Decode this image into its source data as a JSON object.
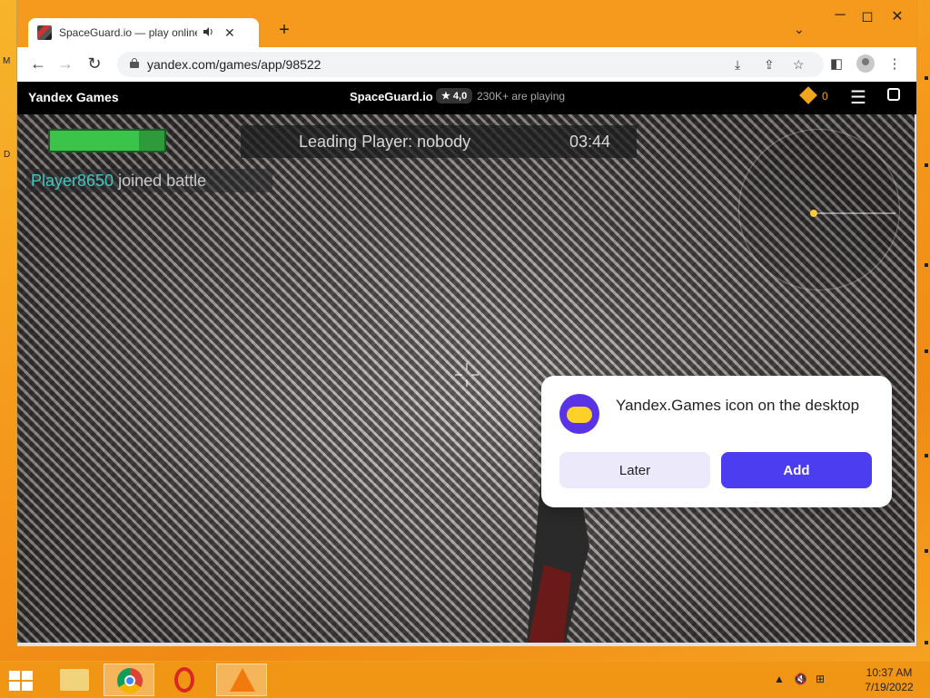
{
  "tab": {
    "title": "SpaceGuard.io — play online",
    "audio_icon": "speaker-icon",
    "close": "✕",
    "new_tab": "+"
  },
  "toolbar": {
    "back": "←",
    "forward": "→",
    "reload": "↻",
    "url": "yandex.com/games/app/98522"
  },
  "yandex_header": {
    "brand": "Yandex Games",
    "game_title": "SpaceGuard.io",
    "rating": "★ 4,0",
    "players": "230K+ are playing",
    "coins": "0"
  },
  "game": {
    "health_fraction": 0.78,
    "leading_player": "Leading Player: nobody",
    "timer": "03:44",
    "killfeed_player": "Player8650",
    "killfeed_action": "joined battle"
  },
  "popup": {
    "title": "Yandex.Games icon on the desktop",
    "later": "Later",
    "add": "Add"
  },
  "taskbar": {
    "time": "10:37 AM",
    "date": "7/19/2022"
  },
  "desktop": {
    "left_labels": [
      "M",
      "D"
    ]
  },
  "colors": {
    "accent": "#4d3df0",
    "killfeed_player": "#3fc7c0",
    "health": "#3ac44a",
    "taskbar": "#f0961a"
  }
}
